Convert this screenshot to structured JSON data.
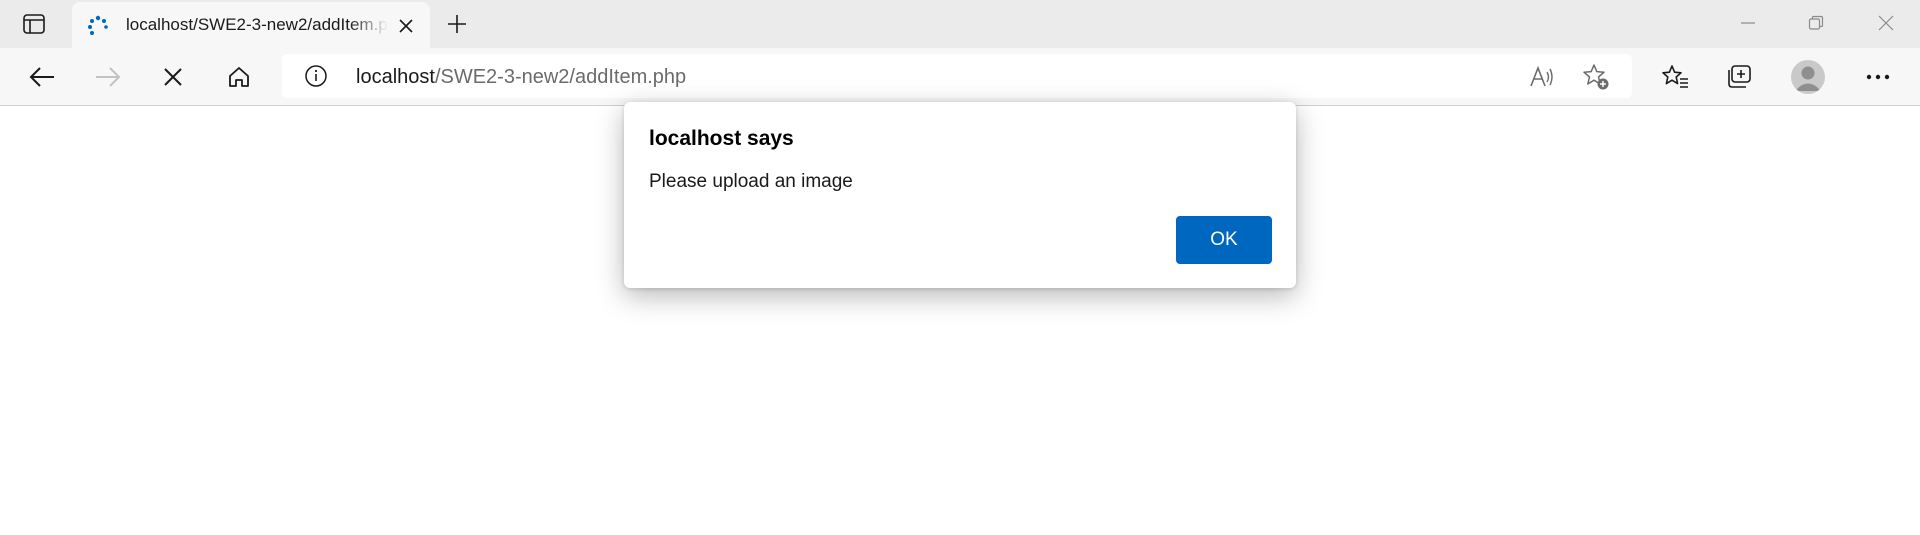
{
  "browser": {
    "tab": {
      "title": "localhost/SWE2-3-new2/addItem.php"
    },
    "address": {
      "host": "localhost",
      "path": "/SWE2-3-new2/addItem.php"
    },
    "accent_color": "#0067c0",
    "icons": [
      "tab-actions-icon",
      "loading-spinner-icon",
      "close-icon",
      "plus-icon",
      "minimize-icon",
      "restore-icon",
      "window-close-icon",
      "back-arrow-icon",
      "forward-arrow-icon",
      "stop-icon",
      "home-icon",
      "info-icon",
      "read-aloud-icon",
      "add-favorite-icon",
      "favorites-icon",
      "collections-icon",
      "profile-icon",
      "more-icon"
    ]
  },
  "dialog": {
    "title": "localhost says",
    "message": "Please upload an image",
    "ok_label": "OK"
  }
}
